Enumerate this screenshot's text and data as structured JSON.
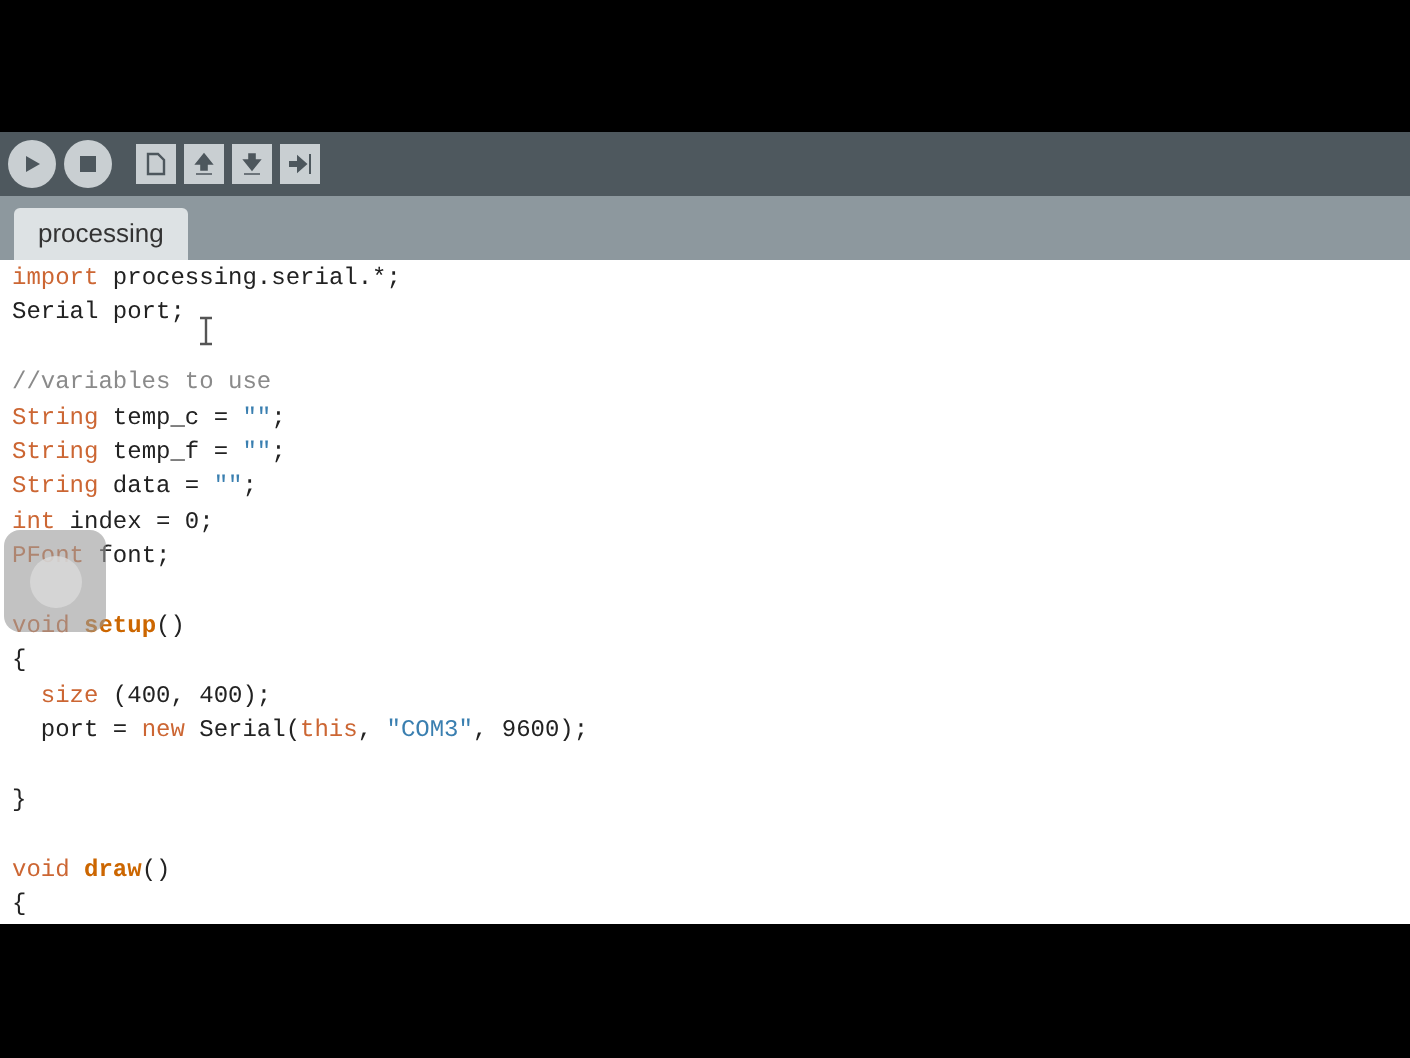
{
  "toolbar": {
    "buttons": [
      {
        "kind": "run"
      },
      {
        "kind": "stop"
      },
      {
        "kind": "new"
      },
      {
        "kind": "open"
      },
      {
        "kind": "save"
      },
      {
        "kind": "export"
      }
    ]
  },
  "tabs": [
    {
      "label": "processing",
      "selected": true
    }
  ],
  "editor": {
    "lines": [
      {
        "kind": "code",
        "tokens": [
          {
            "kind": "keyword",
            "text": "import"
          },
          {
            "kind": "plain",
            "text": " processing.serial.*;"
          }
        ]
      },
      {
        "kind": "code",
        "tokens": [
          {
            "kind": "plain",
            "text": "Serial port;"
          }
        ]
      },
      {
        "kind": "blank"
      },
      {
        "kind": "code",
        "tokens": [
          {
            "kind": "comment",
            "text": "//variables to use"
          }
        ]
      },
      {
        "kind": "code",
        "tokens": [
          {
            "kind": "keyword",
            "text": "String"
          },
          {
            "kind": "plain",
            "text": " temp_c = "
          },
          {
            "kind": "string",
            "text": "\"\""
          },
          {
            "kind": "plain",
            "text": ";"
          }
        ]
      },
      {
        "kind": "code",
        "tokens": [
          {
            "kind": "keyword",
            "text": "String"
          },
          {
            "kind": "plain",
            "text": " temp_f = "
          },
          {
            "kind": "string",
            "text": "\"\""
          },
          {
            "kind": "plain",
            "text": ";"
          }
        ]
      },
      {
        "kind": "code",
        "tokens": [
          {
            "kind": "keyword",
            "text": "String"
          },
          {
            "kind": "plain",
            "text": " data = "
          },
          {
            "kind": "string",
            "text": "\"\""
          },
          {
            "kind": "plain",
            "text": ";"
          }
        ]
      },
      {
        "kind": "code",
        "tokens": [
          {
            "kind": "keyword",
            "text": "int"
          },
          {
            "kind": "plain",
            "text": " index = 0;"
          }
        ]
      },
      {
        "kind": "code",
        "tokens": [
          {
            "kind": "keyword",
            "text": "PFont"
          },
          {
            "kind": "plain",
            "text": " font;"
          }
        ]
      },
      {
        "kind": "blank"
      },
      {
        "kind": "code",
        "tokens": [
          {
            "kind": "keyword",
            "text": "void"
          },
          {
            "kind": "function",
            "text": " setup"
          },
          {
            "kind": "plain",
            "text": "()"
          }
        ]
      },
      {
        "kind": "code",
        "tokens": [
          {
            "kind": "plain",
            "text": "{"
          }
        ]
      },
      {
        "kind": "code",
        "tokens": [
          {
            "kind": "keyword",
            "text": "  size"
          },
          {
            "kind": "plain",
            "text": " (400, 400);"
          }
        ]
      },
      {
        "kind": "code",
        "tokens": [
          {
            "kind": "plain",
            "text": "  port = "
          },
          {
            "kind": "keyword",
            "text": "new"
          },
          {
            "kind": "plain",
            "text": " Serial("
          },
          {
            "kind": "keyword",
            "text": "this"
          },
          {
            "kind": "plain",
            "text": ", "
          },
          {
            "kind": "string",
            "text": "\"COM3\""
          },
          {
            "kind": "plain",
            "text": ", 9600);"
          }
        ]
      },
      {
        "kind": "blank"
      },
      {
        "kind": "code",
        "tokens": [
          {
            "kind": "plain",
            "text": "}"
          }
        ]
      },
      {
        "kind": "blank"
      },
      {
        "kind": "code",
        "tokens": [
          {
            "kind": "keyword",
            "text": "void"
          },
          {
            "kind": "function",
            "text": " draw"
          },
          {
            "kind": "plain",
            "text": "()"
          }
        ]
      },
      {
        "kind": "code",
        "tokens": [
          {
            "kind": "plain",
            "text": "{"
          }
        ]
      }
    ]
  }
}
